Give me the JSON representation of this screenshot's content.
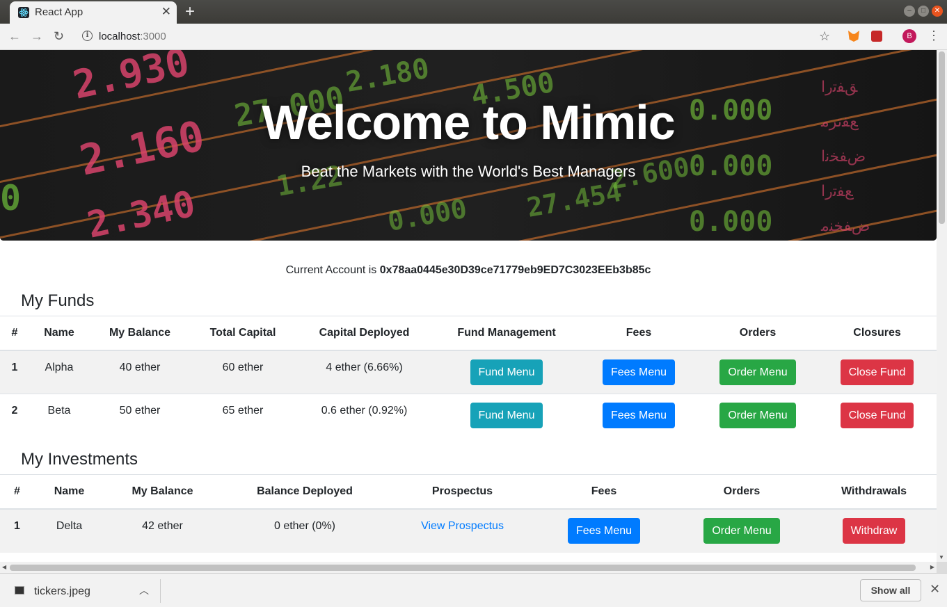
{
  "browser": {
    "tab_title": "React App",
    "tab_close": "✕",
    "new_tab": "+",
    "url_host": "localhost",
    "url_port": ":3000",
    "avatar_letter": "B"
  },
  "hero": {
    "title": "Welcome to Mimic",
    "subtitle": "Beat the Markets with the World's Best Managers"
  },
  "account": {
    "prefix": "Current Account is",
    "address": "0x78aa0445e30D39ce71779eb9ED7C3023EEb3b85c"
  },
  "funds": {
    "title": "My Funds",
    "headers": [
      "#",
      "Name",
      "My Balance",
      "Total Capital",
      "Capital Deployed",
      "Fund Management",
      "Fees",
      "Orders",
      "Closures"
    ],
    "rows": [
      {
        "num": "1",
        "name": "Alpha",
        "balance": "40 ether",
        "total": "60 ether",
        "deployed": "4 ether (6.66%)",
        "fund_btn": "Fund Menu",
        "fees_btn": "Fees Menu",
        "order_btn": "Order Menu",
        "close_btn": "Close Fund"
      },
      {
        "num": "2",
        "name": "Beta",
        "balance": "50 ether",
        "total": "65 ether",
        "deployed": "0.6 ether (0.92%)",
        "fund_btn": "Fund Menu",
        "fees_btn": "Fees Menu",
        "order_btn": "Order Menu",
        "close_btn": "Close Fund"
      }
    ]
  },
  "investments": {
    "title": "My Investments",
    "headers": [
      "#",
      "Name",
      "My Balance",
      "Balance Deployed",
      "Prospectus",
      "Fees",
      "Orders",
      "Withdrawals"
    ],
    "rows": [
      {
        "num": "1",
        "name": "Delta",
        "balance": "42 ether",
        "deployed": "0 ether (0%)",
        "prospectus_link": "View Prospectus",
        "fees_btn": "Fees Menu",
        "order_btn": "Order Menu",
        "withdraw_btn": "Withdraw"
      }
    ]
  },
  "downloads": {
    "file_name": "tickers.jpeg",
    "show_all": "Show all"
  },
  "colors": {
    "info": "#17a2b8",
    "primary": "#007bff",
    "success": "#28a745",
    "danger": "#dc3545"
  }
}
